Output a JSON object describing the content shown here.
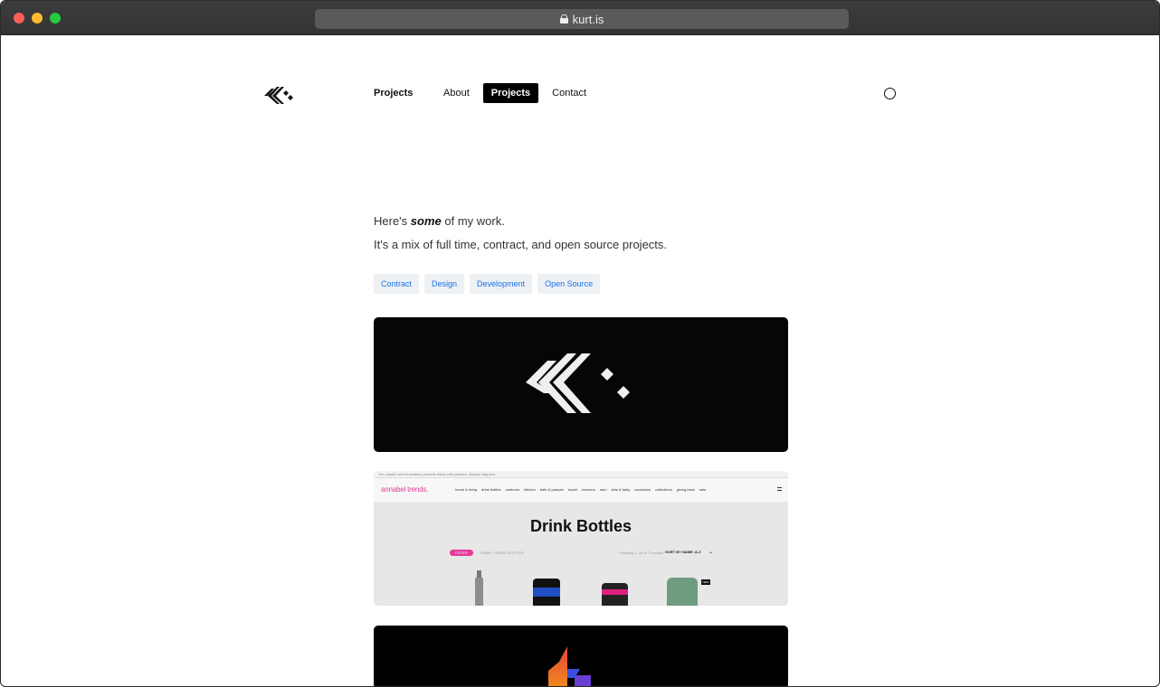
{
  "browser": {
    "url": "kurt.is"
  },
  "header": {
    "current_section": "Projects",
    "nav": [
      {
        "label": "About",
        "active": false
      },
      {
        "label": "Projects",
        "active": true
      },
      {
        "label": "Contact",
        "active": false
      }
    ]
  },
  "intro": {
    "line1_prefix": "Here's ",
    "line1_emphasis": "some",
    "line1_suffix": " of my work.",
    "line2": "It's a mix of full time, contract, and open source projects."
  },
  "tags": [
    "Contract",
    "Design",
    "Development",
    "Open Source"
  ],
  "cards": {
    "card2": {
      "topbar_text": "fun, playful and innovative products made with passion. Always happens.",
      "brand": "annabel trends.",
      "menu": [
        "home & living",
        "drink bottles",
        "outdoors",
        "kitchen",
        "bath & pamper",
        "travel",
        "womens",
        "men",
        "kids & baby",
        "occasions",
        "collections",
        "giving back",
        "sale"
      ],
      "title": "Drink Bottles",
      "filter_label": "FILTER",
      "breadcrumb": "HOME > DRINK BOTTLES",
      "showing": "Showing 1–16 of 73 results",
      "sort_label": "SORT BY NAME: A-Z",
      "badge": "NEW"
    }
  },
  "colors": {
    "link_blue": "#1b73e8",
    "tag_bg": "#eef1f4",
    "brand_pink": "#e6399b"
  }
}
